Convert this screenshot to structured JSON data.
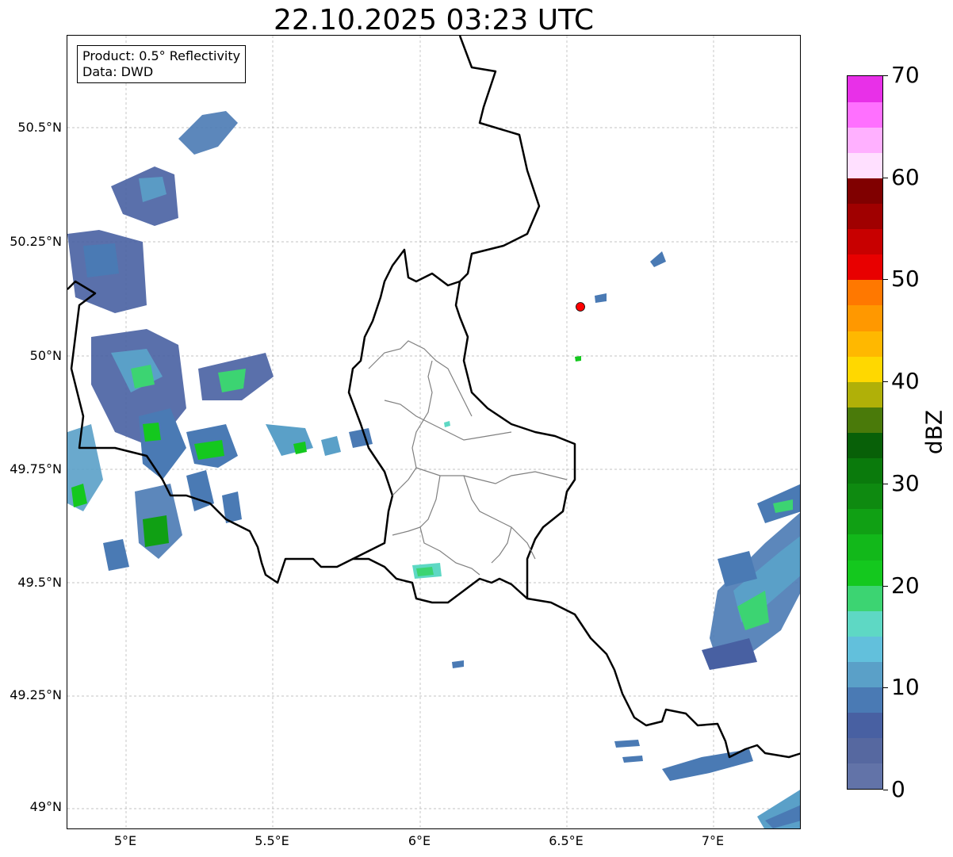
{
  "title": "22.10.2025 03:23 UTC",
  "info": {
    "product": "Product: 0.5° Reflectivity",
    "data": "Data: DWD"
  },
  "map": {
    "lon_range": [
      4.8,
      7.3
    ],
    "lat_range": [
      48.95,
      50.7
    ],
    "x_ticks": [
      {
        "lon": 5.0,
        "label": "5°E"
      },
      {
        "lon": 5.5,
        "label": "5.5°E"
      },
      {
        "lon": 6.0,
        "label": "6°E"
      },
      {
        "lon": 6.5,
        "label": "6.5°E"
      },
      {
        "lon": 7.0,
        "label": "7°E"
      }
    ],
    "y_ticks": [
      {
        "lat": 50.5,
        "label": "50.5°N"
      },
      {
        "lat": 50.25,
        "label": "50.25°N"
      },
      {
        "lat": 50.0,
        "label": "50°N"
      },
      {
        "lat": 49.75,
        "label": "49.75°N"
      },
      {
        "lat": 49.5,
        "label": "49.5°N"
      },
      {
        "lat": 49.25,
        "label": "49.25°N"
      },
      {
        "lat": 49.0,
        "label": "49°N"
      }
    ],
    "grid": true,
    "radar_site": {
      "lon": 6.55,
      "lat": 50.11,
      "color": "#ff0000"
    }
  },
  "colorbar": {
    "unit": "dBZ",
    "min": 0,
    "max": 70,
    "ticks": [
      {
        "value": 0,
        "label": "0"
      },
      {
        "value": 10,
        "label": "10"
      },
      {
        "value": 20,
        "label": "20"
      },
      {
        "value": 30,
        "label": "30"
      },
      {
        "value": 40,
        "label": "40"
      },
      {
        "value": 50,
        "label": "50"
      },
      {
        "value": 60,
        "label": "60"
      },
      {
        "value": 70,
        "label": "70"
      }
    ],
    "colors": [
      "#6273a8",
      "#5668a0",
      "#4860a2",
      "#4a7ab4",
      "#5aa0c8",
      "#62c0dc",
      "#5ed8c4",
      "#3cd472",
      "#14c81e",
      "#12b81a",
      "#10a014",
      "#0e8a10",
      "#0a7a0c",
      "#086008",
      "#4a7a0a",
      "#b0b008",
      "#ffd800",
      "#ffb800",
      "#ff9800",
      "#ff7800",
      "#e80000",
      "#c80000",
      "#a00000",
      "#800000",
      "#ffe0ff",
      "#ffb0ff",
      "#ff70ff",
      "#e830e8"
    ]
  }
}
